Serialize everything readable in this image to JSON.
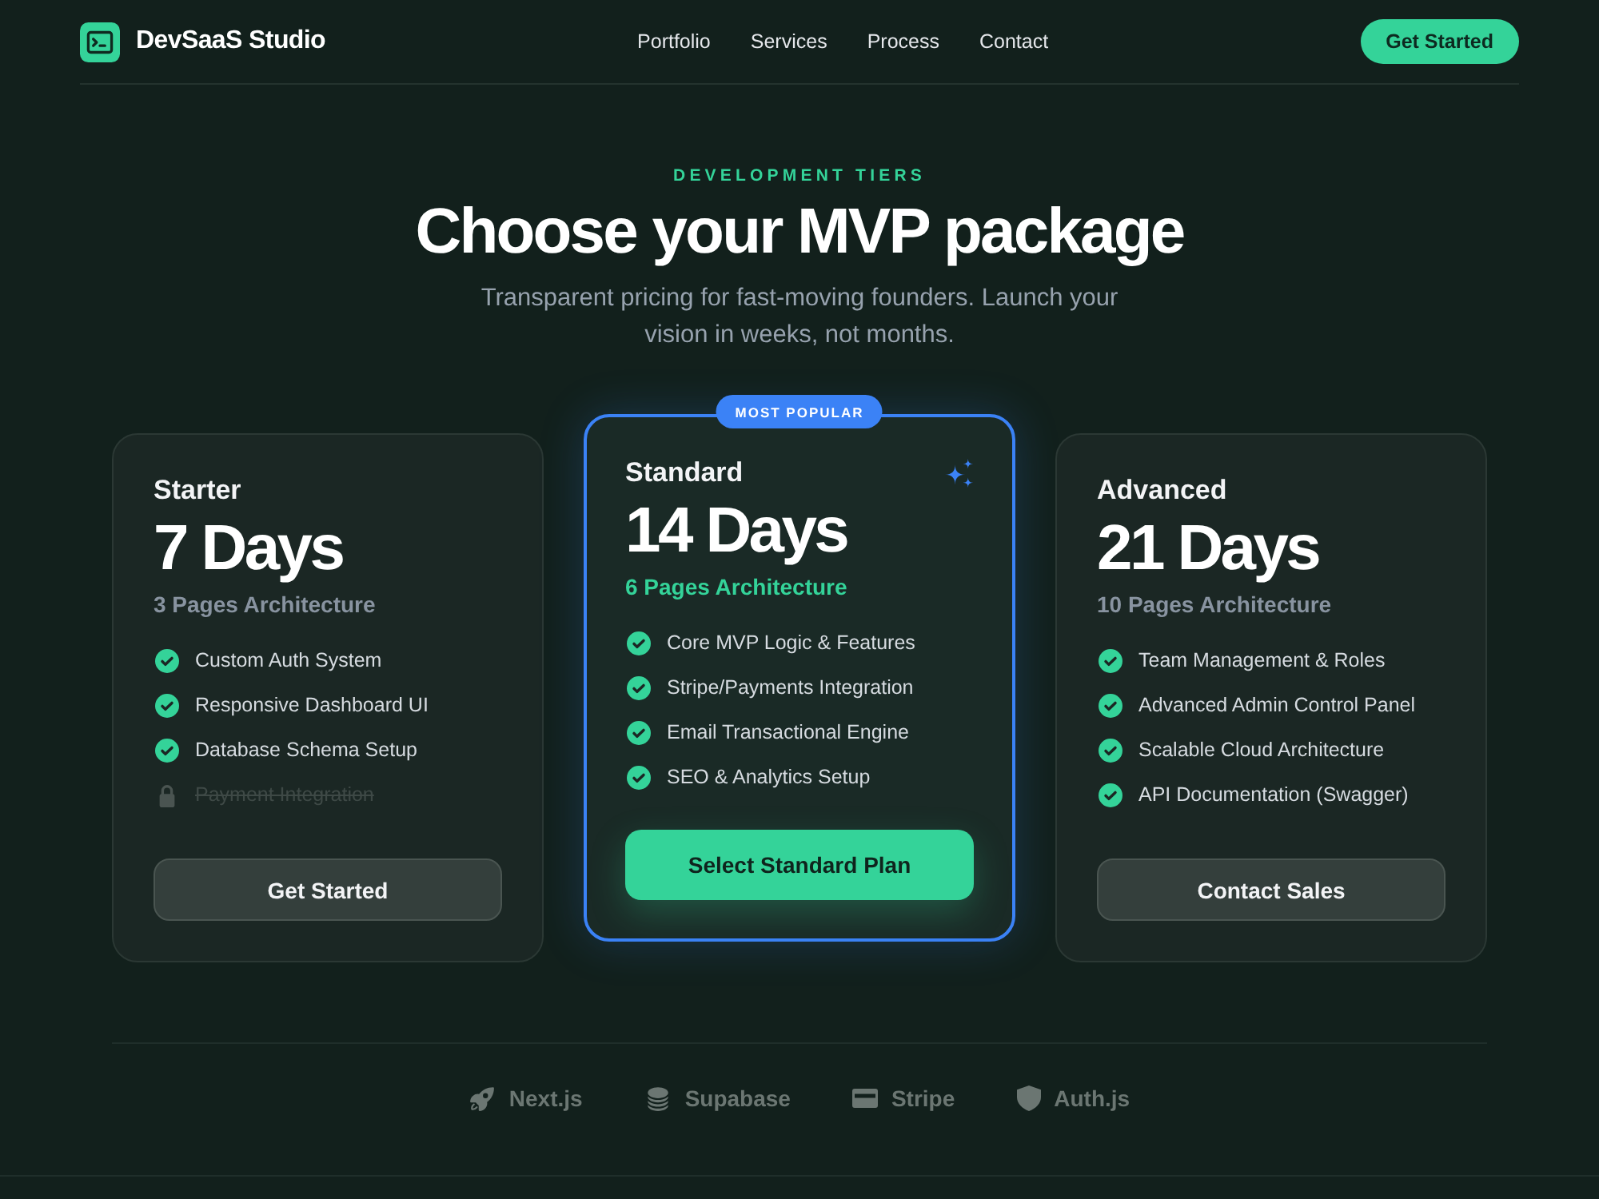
{
  "header": {
    "brand": "DevSaaS Studio",
    "nav": [
      "Portfolio",
      "Services",
      "Process",
      "Contact"
    ],
    "cta": "Get Started"
  },
  "hero": {
    "eyebrow": "DEVELOPMENT TIERS",
    "title": "Choose your MVP package",
    "subtitle": "Transparent pricing for fast-moving founders. Launch your vision in weeks, not months."
  },
  "plans": [
    {
      "name": "Starter",
      "duration": "7 Days",
      "pages": "3 Pages Architecture",
      "featured": false,
      "features": [
        {
          "label": "Custom Auth System",
          "included": true
        },
        {
          "label": "Responsive Dashboard UI",
          "included": true
        },
        {
          "label": "Database Schema Setup",
          "included": true
        },
        {
          "label": "Payment Integration",
          "included": false
        }
      ],
      "button": "Get Started"
    },
    {
      "name": "Standard",
      "badge": "MOST POPULAR",
      "duration": "14 Days",
      "pages": "6 Pages Architecture",
      "featured": true,
      "features": [
        {
          "label": "Core MVP Logic & Features",
          "included": true
        },
        {
          "label": "Stripe/Payments Integration",
          "included": true
        },
        {
          "label": "Email Transactional Engine",
          "included": true
        },
        {
          "label": "SEO & Analytics Setup",
          "included": true
        }
      ],
      "button": "Select Standard Plan"
    },
    {
      "name": "Advanced",
      "duration": "21 Days",
      "pages": "10 Pages Architecture",
      "featured": false,
      "features": [
        {
          "label": "Team Management & Roles",
          "included": true
        },
        {
          "label": "Advanced Admin Control Panel",
          "included": true
        },
        {
          "label": "Scalable Cloud Architecture",
          "included": true
        },
        {
          "label": "API Documentation (Swagger)",
          "included": true
        }
      ],
      "button": "Contact Sales"
    }
  ],
  "tech_stack": [
    {
      "label": "Next.js",
      "kind": "rocket"
    },
    {
      "label": "Supabase",
      "kind": "database"
    },
    {
      "label": "Stripe",
      "kind": "card"
    },
    {
      "label": "Auth.js",
      "kind": "shield"
    }
  ]
}
